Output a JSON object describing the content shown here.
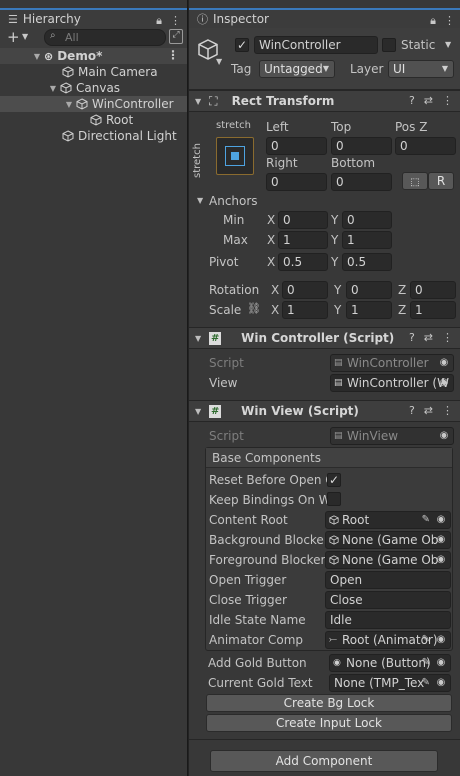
{
  "hierarchy": {
    "tab_label": "Hierarchy",
    "search_placeholder": "All",
    "items": [
      {
        "label": "Demo*",
        "depth": 0
      },
      {
        "label": "Main Camera",
        "depth": 1
      },
      {
        "label": "Canvas",
        "depth": 1
      },
      {
        "label": "WinController",
        "depth": 2
      },
      {
        "label": "Root",
        "depth": 3
      },
      {
        "label": "Directional Light",
        "depth": 1
      }
    ]
  },
  "inspector": {
    "tab_label": "Inspector",
    "object_name": "WinController",
    "static_label": "Static",
    "tag_label": "Tag",
    "tag_value": "Untagged",
    "layer_label": "Layer",
    "layer_value": "UI",
    "rect_transform": {
      "title": "Rect Transform",
      "stretch_top": "stretch",
      "stretch_side": "stretch",
      "left_label": "Left",
      "left_value": "0",
      "top_label": "Top",
      "top_value": "0",
      "posz_label": "Pos Z",
      "posz_value": "0",
      "right_label": "Right",
      "right_value": "0",
      "bottom_label": "Bottom",
      "bottom_value": "0",
      "r_button": "R",
      "anchors_label": "Anchors",
      "min_label": "Min",
      "min_x": "0",
      "min_y": "0",
      "max_label": "Max",
      "max_x": "1",
      "max_y": "1",
      "pivot_label": "Pivot",
      "pivot_x": "0.5",
      "pivot_y": "0.5",
      "rotation_label": "Rotation",
      "rot_x": "0",
      "rot_y": "0",
      "rot_z": "0",
      "scale_label": "Scale",
      "scale_x": "1",
      "scale_y": "1",
      "scale_z": "1",
      "x_label": "X",
      "y_label": "Y",
      "z_label": "Z"
    },
    "win_controller": {
      "title": "Win Controller (Script)",
      "script_label": "Script",
      "script_value": "WinController",
      "view_label": "View",
      "view_value": "WinController (W"
    },
    "win_view": {
      "title": "Win View (Script)",
      "script_label": "Script",
      "script_value": "WinView",
      "base_components_label": "Base Components",
      "reset_label": "Reset Before Open C",
      "keep_label": "Keep Bindings On Wi",
      "content_root_label": "Content Root",
      "content_root_value": "Root",
      "bg_blocker_label": "Background Blocker",
      "bg_blocker_value": "None (Game Ob",
      "fg_blocker_label": "Foreground Blocker",
      "fg_blocker_value": "None (Game Ob",
      "open_trigger_label": "Open Trigger",
      "open_trigger_value": "Open",
      "close_trigger_label": "Close Trigger",
      "close_trigger_value": "Close",
      "idle_state_label": "Idle State Name",
      "idle_state_value": "Idle",
      "animator_label": "Animator Comp",
      "animator_value": "Root (Animator)",
      "add_gold_label": "Add Gold Button",
      "add_gold_value": "None (Button)",
      "gold_text_label": "Current Gold Text",
      "gold_text_value": "None (TMP_Tex",
      "create_bg_lock": "Create Bg Lock",
      "create_input_lock": "Create Input Lock"
    },
    "add_component": "Add Component"
  }
}
